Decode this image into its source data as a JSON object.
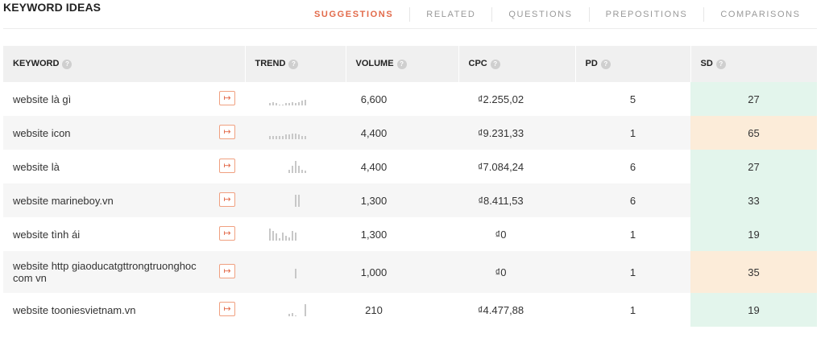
{
  "title": "KEYWORD IDEAS",
  "tabs": [
    {
      "label": "SUGGESTIONS",
      "active": true
    },
    {
      "label": "RELATED",
      "active": false
    },
    {
      "label": "QUESTIONS",
      "active": false
    },
    {
      "label": "PREPOSITIONS",
      "active": false
    },
    {
      "label": "COMPARISONS",
      "active": false
    }
  ],
  "columns": {
    "keyword": "KEYWORD",
    "trend": "TREND",
    "volume": "VOLUME",
    "cpc": "CPC",
    "pd": "PD",
    "sd": "SD"
  },
  "goto_icon": "↦",
  "help_icon": "?",
  "colors": {
    "accent": "#e26a4a",
    "sd_easy": "#e3f5ec",
    "sd_hard": "#fcecd9"
  },
  "rows": [
    {
      "keyword": "website là gì",
      "volume": "6,600",
      "cpc": "₫2.255,02",
      "pd": "5",
      "sd": "27",
      "sd_level": "easy",
      "trend": [
        2,
        3,
        2,
        1,
        1,
        2,
        2,
        3,
        2,
        3,
        4,
        5
      ]
    },
    {
      "keyword": "website icon",
      "volume": "4,400",
      "cpc": "₫9.231,33",
      "pd": "1",
      "sd": "65",
      "sd_level": "hard",
      "trend": [
        3,
        3,
        3,
        3,
        3,
        4,
        4,
        5,
        5,
        4,
        3,
        3
      ]
    },
    {
      "keyword": "website là",
      "volume": "4,400",
      "cpc": "₫7.084,24",
      "pd": "6",
      "sd": "27",
      "sd_level": "easy",
      "trend": [
        0,
        0,
        0,
        0,
        0,
        0,
        3,
        6,
        10,
        6,
        3,
        2
      ]
    },
    {
      "keyword": "website marineboy.vn",
      "volume": "1,300",
      "cpc": "₫8.411,53",
      "pd": "6",
      "sd": "33",
      "sd_level": "easy",
      "trend": [
        0,
        0,
        0,
        0,
        0,
        0,
        0,
        0,
        10,
        10,
        0,
        0
      ]
    },
    {
      "keyword": "website tình ái",
      "volume": "1,300",
      "cpc": "₫0",
      "pd": "1",
      "sd": "19",
      "sd_level": "easy",
      "trend": [
        10,
        8,
        6,
        2,
        7,
        4,
        3,
        8,
        7,
        0,
        0,
        0
      ]
    },
    {
      "keyword": "website http giaoducatgttrongtruonghoc com vn",
      "volume": "1,000",
      "cpc": "₫0",
      "pd": "1",
      "sd": "35",
      "sd_level": "hard",
      "trend": [
        0,
        0,
        0,
        0,
        0,
        0,
        0,
        0,
        8,
        0,
        0,
        0
      ]
    },
    {
      "keyword": "website tooniesvietnam.vn",
      "volume": "210",
      "cpc": "₫4.477,88",
      "pd": "1",
      "sd": "19",
      "sd_level": "easy",
      "trend": [
        0,
        0,
        0,
        0,
        0,
        0,
        2,
        3,
        1,
        0,
        0,
        10
      ]
    }
  ]
}
